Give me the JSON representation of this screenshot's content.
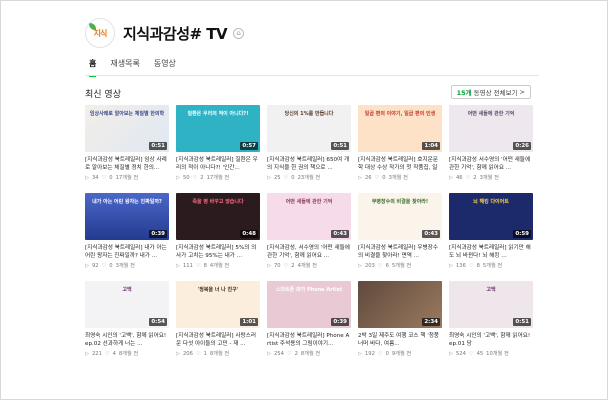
{
  "header": {
    "logo_text": "지식",
    "title": "지식과감성# TV"
  },
  "tabs": [
    {
      "label": "홈",
      "active": true
    },
    {
      "label": "재생목록",
      "active": false
    },
    {
      "label": "동영상",
      "active": false
    }
  ],
  "section": {
    "title": "최신 영상",
    "view_all_count": "15개",
    "view_all_label": "동영상 전체보기",
    "view_all_chevron": ">"
  },
  "videos": [
    {
      "title": "[지식과감성 북트레일러] 임상 사례로 알아보는 체질별 정치 한의...",
      "duration": "0:51",
      "views": "34",
      "likes": "0",
      "age": "17개월 전",
      "thumb_text": "임상사례로 알아보는 체질별 한의학"
    },
    {
      "title": "[지식과감성 북트레일러] 질환은 우리의 적이 아니다?! '인간...",
      "duration": "0:57",
      "views": "50",
      "likes": "2",
      "age": "17개월 전",
      "thumb_text": "질환은 우리의 적이 아니다?!"
    },
    {
      "title": "[지식과감성 북트레일러] 650여 개의 지식을 한 권의 책으로 ...",
      "duration": "0:51",
      "views": "25",
      "likes": "0",
      "age": "23개월 전",
      "thumb_text": "당신의 1%를 만듭니다"
    },
    {
      "title": "[지식과감성 북트레일러] 호지운문학 대상 수상 작가의 첫 작품집, 일곱 편...",
      "duration": "1:04",
      "views": "26",
      "likes": "0",
      "age": "3개월 전",
      "thumb_text": "일곱 편의 이야기, 일곱 편의 인생"
    },
    {
      "title": "[지식과감성 서수영의 '어떤 새들에 관한 기억', 함께 읽어요 ...",
      "duration": "0:26",
      "views": "46",
      "likes": "2",
      "age": "3개월 전",
      "thumb_text": "어떤 새들에 관한 기억"
    },
    {
      "title": "[지식과감성 북트레일러] 내가 아는 어린 왕자는 진짜일까? 내가 ...",
      "duration": "0:39",
      "views": "92",
      "likes": "0",
      "age": "3개월 전",
      "thumb_text": "내가 아는 어린 왕자는 진짜일까?"
    },
    {
      "title": "[지식과감성 북트레일러] 5%의 의사가 고치는 95%는 내가 ...",
      "duration": "0:48",
      "views": "111",
      "likes": "8",
      "age": "4개월 전",
      "thumb_text": "죽을 병 바꾸고 않습니다"
    },
    {
      "title": "[지식과감성, 서수영의 '어떤 새들에 관한 기억', 함께 읽어요 ...",
      "duration": "0:43",
      "views": "70",
      "likes": "2",
      "age": "4개월 전",
      "thumb_text": "어떤 새들에 관한 기억"
    },
    {
      "title": "[지식과감성 북트레일러] 우병장수의 비결을 찾아라! 면역 ...",
      "duration": "0:43",
      "views": "203",
      "likes": "6",
      "age": "5개월 전",
      "thumb_text": "무병장수의 비결을 찾아라!"
    },
    {
      "title": "[지식과감성 북트레일러] 읽기만 해도 뇌 바뀐다! 뇌 해킹 ...",
      "duration": "0:59",
      "views": "136",
      "likes": "8",
      "age": "5개월 전",
      "thumb_text": "뇌 해킹 다이어트"
    },
    {
      "title": "최영숙 시인의 '고백', 함께 읽어요! ep.02 선과하게 너는 ...",
      "duration": "0:54",
      "views": "221",
      "likes": "4",
      "age": "8개월 전",
      "thumb_text": "고백"
    },
    {
      "title": "[지식과감성 북트레일러] 사랑스러운 다섯 아이들의 고민 - 재 ...",
      "duration": "1:01",
      "views": "206",
      "likes": "1",
      "age": "8개월 전",
      "thumb_text": "'정복을 너 나 친구'"
    },
    {
      "title": "[지식과감성 북트레일러] Phone Artist 주석용의 그림이야기...",
      "duration": "0:39",
      "views": "254",
      "likes": "2",
      "age": "8개월 전",
      "thumb_text": "스마트폰 화가 Phone Artist"
    },
    {
      "title": "2박 3일 제주도 여행 코스 책 '청풍 너머 바다, 여름...",
      "duration": "2:34",
      "views": "192",
      "likes": "0",
      "age": "9개월 전",
      "thumb_text": ""
    },
    {
      "title": "최영숙 시인의 '고백', 함께 읽어요! ep.01 당",
      "duration": "0:51",
      "views": "524",
      "likes": "45",
      "age": "10개월 전",
      "thumb_text": "고백"
    }
  ],
  "icons": {
    "views": "▷",
    "likes": "♡",
    "home": "⌂"
  },
  "colors": {
    "accent": "#00c73c"
  }
}
